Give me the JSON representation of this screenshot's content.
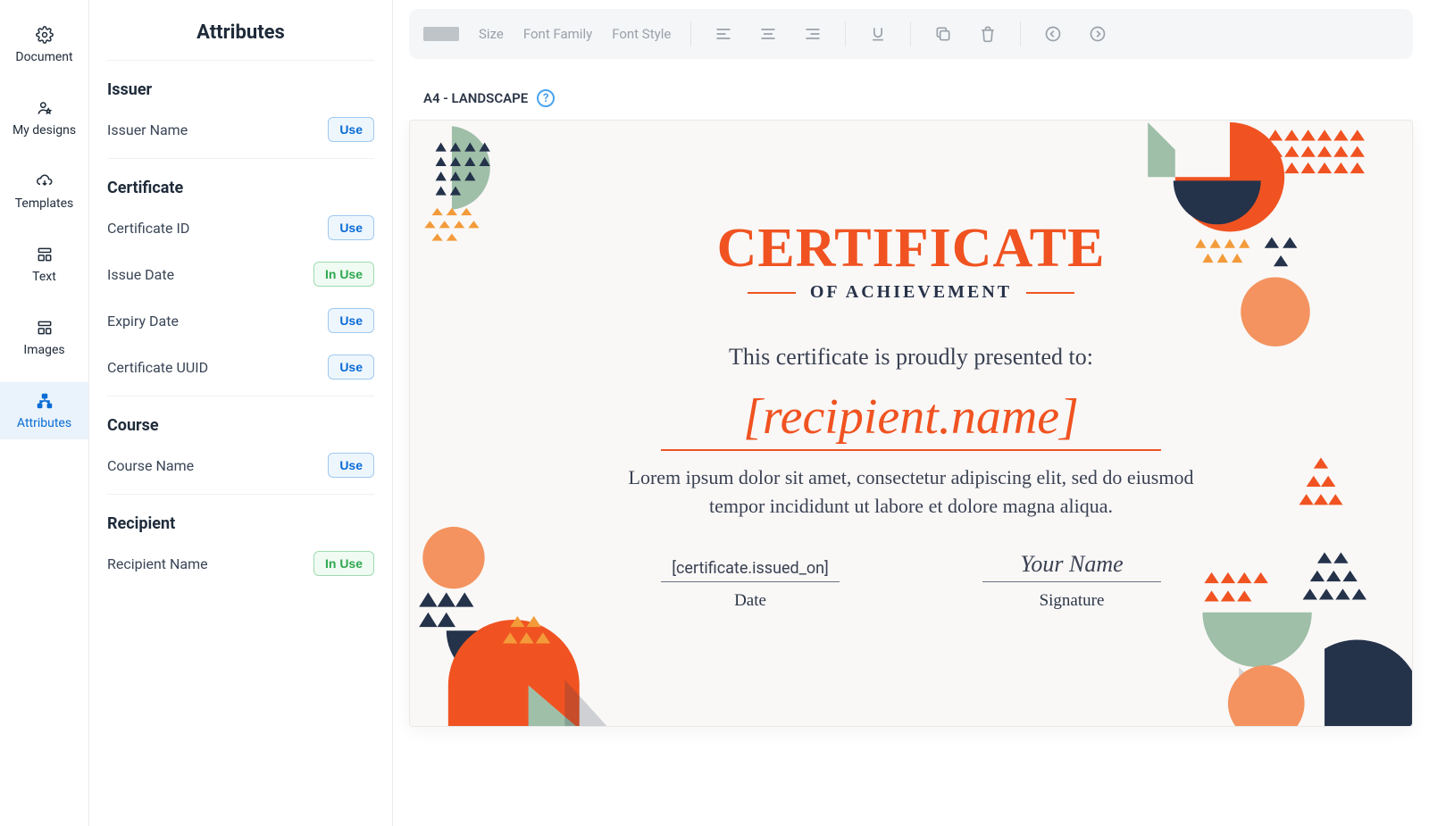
{
  "rail": {
    "items": [
      {
        "key": "document",
        "label": "Document"
      },
      {
        "key": "mydesigns",
        "label": "My designs"
      },
      {
        "key": "templates",
        "label": "Templates"
      },
      {
        "key": "text",
        "label": "Text"
      },
      {
        "key": "images",
        "label": "Images"
      },
      {
        "key": "attributes",
        "label": "Attributes"
      }
    ]
  },
  "panel": {
    "title": "Attributes",
    "buttons": {
      "use": "Use",
      "in_use": "In Use"
    },
    "sections": [
      {
        "title": "Issuer",
        "attrs": [
          {
            "label": "Issuer Name",
            "state": "use"
          }
        ]
      },
      {
        "title": "Certificate",
        "attrs": [
          {
            "label": "Certificate ID",
            "state": "use"
          },
          {
            "label": "Issue Date",
            "state": "in_use"
          },
          {
            "label": "Expiry Date",
            "state": "use"
          },
          {
            "label": "Certificate UUID",
            "state": "use"
          }
        ]
      },
      {
        "title": "Course",
        "attrs": [
          {
            "label": "Course Name",
            "state": "use"
          }
        ]
      },
      {
        "title": "Recipient",
        "attrs": [
          {
            "label": "Recipient Name",
            "state": "in_use"
          }
        ]
      }
    ]
  },
  "toolbar": {
    "size_label": "Size",
    "font_family_label": "Font Family",
    "font_style_label": "Font Style"
  },
  "canvas": {
    "format_label": "A4 - LANDSCAPE"
  },
  "certificate": {
    "title": "CERTIFICATE",
    "subtitle": "OF ACHIEVEMENT",
    "presented_line": "This certificate is proudly presented to:",
    "recipient_placeholder": "[recipient.name]",
    "body_text": "Lorem ipsum dolor sit amet, consectetur adipiscing elit, sed do eiusmod tempor incididunt ut labore et dolore magna aliqua.",
    "date_value": "[certificate.issued_on]",
    "date_label": "Date",
    "signature_value": "Your Name",
    "signature_label": "Signature"
  }
}
